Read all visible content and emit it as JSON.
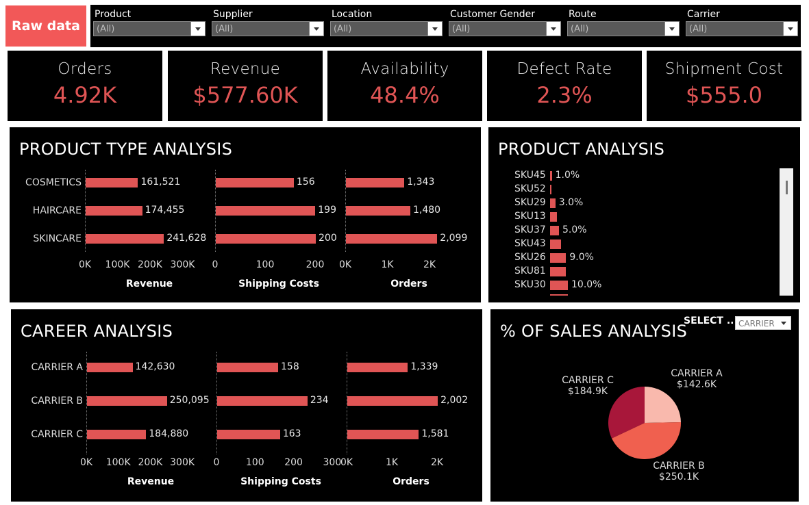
{
  "raw_data_button": "Raw data",
  "filters": [
    {
      "label": "Product",
      "value": "(All)"
    },
    {
      "label": "Supplier",
      "value": "(All)"
    },
    {
      "label": "Location",
      "value": "(All)"
    },
    {
      "label": "Customer Gender",
      "value": "(All)"
    },
    {
      "label": "Route",
      "value": "(All)"
    },
    {
      "label": "Carrier",
      "value": "(All)"
    }
  ],
  "kpis": [
    {
      "label": "Orders",
      "value": "4.92K"
    },
    {
      "label": "Revenue",
      "value": "$577.60K"
    },
    {
      "label": "Availability",
      "value": "48.4%"
    },
    {
      "label": "Defect Rate",
      "value": "2.3%"
    },
    {
      "label": "Shipment Cost",
      "value": "$555.0"
    }
  ],
  "colors": {
    "accent": "#e05555",
    "button": "#f25858",
    "panel": "#000000"
  },
  "product_type": {
    "title": "PRODUCT TYPE ANALYSIS",
    "categories": [
      "COSMETICS",
      "HAIRCARE",
      "SKINCARE"
    ],
    "revenue": {
      "values": [
        161521,
        174455,
        241628
      ],
      "labels": [
        "161,521",
        "174,455",
        "241,628"
      ],
      "ticks": [
        "0K",
        "100K",
        "200K",
        "300K"
      ],
      "max": 300000,
      "title": "Revenue"
    },
    "shipping": {
      "values": [
        156,
        199,
        200
      ],
      "labels": [
        "156",
        "199",
        "200"
      ],
      "ticks": [
        "0",
        "100",
        "200"
      ],
      "max": 200,
      "title": "Shipping Costs"
    },
    "orders": {
      "values": [
        1343,
        1480,
        2099
      ],
      "labels": [
        "1,343",
        "1,480",
        "2,099"
      ],
      "ticks": [
        "0K",
        "1K",
        "2K"
      ],
      "max": 2000,
      "title": "Orders"
    }
  },
  "career": {
    "title": "CAREER ANALYSIS",
    "categories": [
      "CARRIER A",
      "CARRIER B",
      "CARRIER C"
    ],
    "revenue": {
      "values": [
        142630,
        250095,
        184880
      ],
      "labels": [
        "142,630",
        "250,095",
        "184,880"
      ],
      "ticks": [
        "0K",
        "100K",
        "200K",
        "300K"
      ],
      "max": 300000,
      "title": "Revenue"
    },
    "shipping": {
      "values": [
        158,
        234,
        163
      ],
      "labels": [
        "158",
        "234",
        "163"
      ],
      "ticks": [
        "0",
        "100",
        "200",
        "300"
      ],
      "max": 300,
      "title": "Shipping Costs"
    },
    "orders": {
      "values": [
        1339,
        2002,
        1581
      ],
      "labels": [
        "1,339",
        "2,002",
        "1,581"
      ],
      "ticks": [
        "0K",
        "1K",
        "2K"
      ],
      "max": 2000,
      "title": "Orders"
    }
  },
  "product_analysis": {
    "title": "PRODUCT ANALYSIS",
    "items": [
      {
        "sku": "SKU45",
        "value": 1.0,
        "label": "1.0%"
      },
      {
        "sku": "SKU52",
        "value": 0.0,
        "label": ""
      },
      {
        "sku": "SKU29",
        "value": 3.0,
        "label": "3.0%"
      },
      {
        "sku": "SKU13",
        "value": 4.0,
        "label": ""
      },
      {
        "sku": "SKU37",
        "value": 5.0,
        "label": "5.0%"
      },
      {
        "sku": "SKU43",
        "value": 6.0,
        "label": ""
      },
      {
        "sku": "SKU26",
        "value": 9.0,
        "label": "9.0%"
      },
      {
        "sku": "SKU81",
        "value": 9.0,
        "label": ""
      },
      {
        "sku": "SKU30",
        "value": 10.0,
        "label": "10.0%"
      }
    ]
  },
  "sales": {
    "title": "% OF SALES ANALYSIS",
    "select_label": "SELECT ..",
    "select_value": "CARRIER"
  },
  "chart_data": {
    "type": "pie",
    "categories": [
      "CARRIER A",
      "CARRIER B",
      "CARRIER C"
    ],
    "values": [
      142.6,
      250.1,
      184.9
    ],
    "value_labels": [
      "$142.6K",
      "$250.1K",
      "$184.9K"
    ],
    "colors": [
      "#f9b9ad",
      "#f0604f",
      "#a8173a"
    ]
  }
}
